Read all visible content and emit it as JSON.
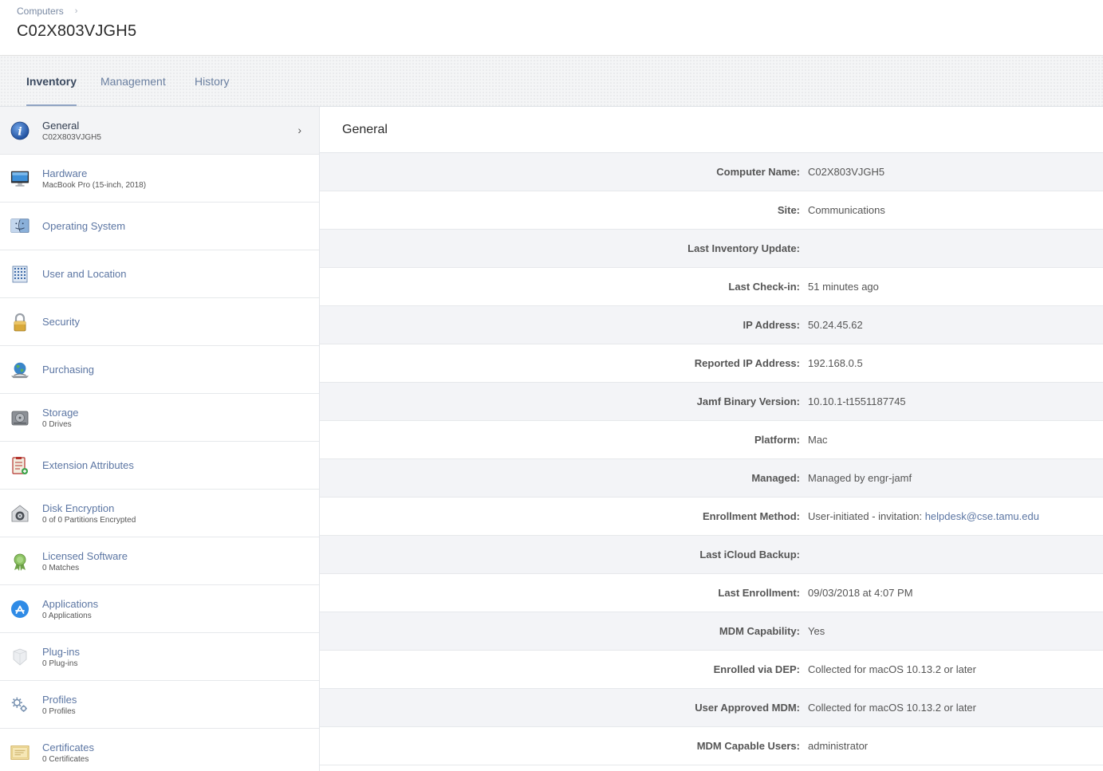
{
  "header": {
    "breadcrumb": "Computers",
    "breadcrumb_sep": "›",
    "title": "C02X803VJGH5"
  },
  "tabs": [
    {
      "label": "Inventory",
      "active": true
    },
    {
      "label": "Management",
      "active": false
    },
    {
      "label": "History",
      "active": false
    }
  ],
  "sidebar": {
    "items": [
      {
        "label": "General",
        "sub": "C02X803VJGH5",
        "icon": "info-icon",
        "active": true,
        "chevron": "›"
      },
      {
        "label": "Hardware",
        "sub": "MacBook Pro (15-inch, 2018)",
        "icon": "monitor-icon"
      },
      {
        "label": "Operating System",
        "sub": "",
        "icon": "finder-icon"
      },
      {
        "label": "User and Location",
        "sub": "",
        "icon": "building-icon"
      },
      {
        "label": "Security",
        "sub": "",
        "icon": "lock-icon"
      },
      {
        "label": "Purchasing",
        "sub": "",
        "icon": "globe-icon"
      },
      {
        "label": "Storage",
        "sub": "0 Drives",
        "icon": "drive-icon"
      },
      {
        "label": "Extension Attributes",
        "sub": "",
        "icon": "clipboard-icon"
      },
      {
        "label": "Disk Encryption",
        "sub": "0 of 0 Partitions Encrypted",
        "icon": "vault-icon"
      },
      {
        "label": "Licensed Software",
        "sub": "0 Matches",
        "icon": "ribbon-icon"
      },
      {
        "label": "Applications",
        "sub": "0 Applications",
        "icon": "app-store-icon"
      },
      {
        "label": "Plug-ins",
        "sub": "0 Plug-ins",
        "icon": "plugin-icon"
      },
      {
        "label": "Profiles",
        "sub": "0 Profiles",
        "icon": "gears-icon"
      },
      {
        "label": "Certificates",
        "sub": "0 Certificates",
        "icon": "certificate-icon"
      }
    ]
  },
  "main": {
    "section_title": "General",
    "rows": [
      {
        "label": "Computer Name:",
        "value": "C02X803VJGH5"
      },
      {
        "label": "Site:",
        "value": "Communications"
      },
      {
        "label": "Last Inventory Update:",
        "value": ""
      },
      {
        "label": "Last Check-in:",
        "value": "51 minutes ago"
      },
      {
        "label": "IP Address:",
        "value": "50.24.45.62"
      },
      {
        "label": "Reported IP Address:",
        "value": "192.168.0.5"
      },
      {
        "label": "Jamf Binary Version:",
        "value": "10.10.1-t1551187745"
      },
      {
        "label": "Platform:",
        "value": "Mac"
      },
      {
        "label": "Managed:",
        "value": "Managed by engr-jamf"
      },
      {
        "label": "Enrollment Method:",
        "value": "User-initiated - invitation:",
        "link": "helpdesk@cse.tamu.edu"
      },
      {
        "label": "Last iCloud Backup:",
        "value": ""
      },
      {
        "label": "Last Enrollment:",
        "value": "09/03/2018 at 4:07 PM"
      },
      {
        "label": "MDM Capability:",
        "value": "Yes"
      },
      {
        "label": "Enrolled via DEP:",
        "value": "Collected for macOS 10.13.2 or later"
      },
      {
        "label": "User Approved MDM:",
        "value": "Collected for macOS 10.13.2 or later"
      },
      {
        "label": "MDM Capable Users:",
        "value": "administrator"
      }
    ]
  }
}
